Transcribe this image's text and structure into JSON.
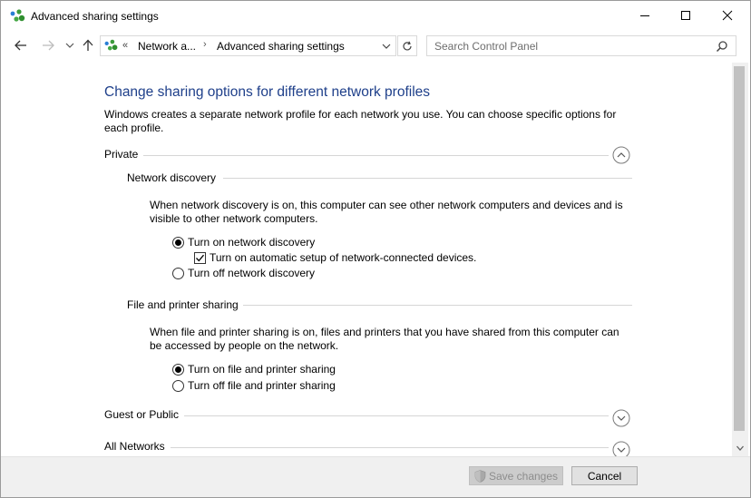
{
  "window": {
    "title": "Advanced sharing settings",
    "icon": "network-sharing-icon"
  },
  "nav": {
    "breadcrumb_overflow": "«",
    "breadcrumb_1": "Network a...",
    "breadcrumb_sep": "›",
    "breadcrumb_2": "Advanced sharing settings",
    "search_placeholder": "Search Control Panel"
  },
  "main": {
    "heading": "Change sharing options for different network profiles",
    "intro": "Windows creates a separate network profile for each network you use. You can choose specific options for each profile.",
    "profiles": {
      "private": {
        "label": "Private",
        "expanded": true,
        "network_discovery": {
          "label": "Network discovery",
          "description": "When network discovery is on, this computer can see other network computers and devices and is visible to other network computers.",
          "options": {
            "on": "Turn on network discovery",
            "auto_setup": "Turn on automatic setup of network-connected devices.",
            "off": "Turn off network discovery"
          },
          "selected": "on",
          "auto_setup_checked": true
        },
        "file_printer": {
          "label": "File and printer sharing",
          "description": "When file and printer sharing is on, files and printers that you have shared from this computer can be accessed by people on the network.",
          "options": {
            "on": "Turn on file and printer sharing",
            "off": "Turn off file and printer sharing"
          },
          "selected": "on"
        }
      },
      "guest_public": {
        "label": "Guest or Public",
        "expanded": false
      },
      "all_networks": {
        "label": "All Networks",
        "expanded": false
      }
    }
  },
  "footer": {
    "save_label": "Save changes",
    "save_enabled": false,
    "cancel_label": "Cancel"
  },
  "colors": {
    "heading": "#1e3f8a",
    "footer_bg": "#f0f0f0",
    "divider": "#d6d6d6"
  }
}
